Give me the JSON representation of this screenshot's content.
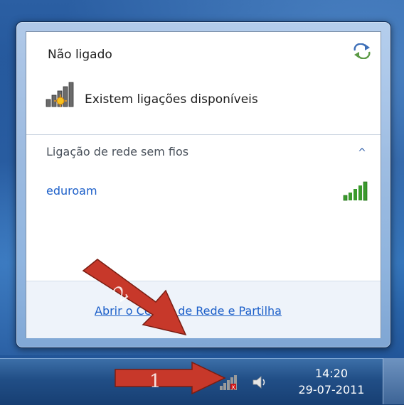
{
  "flyout": {
    "status_title": "Não ligado",
    "availability_text": "Existem ligações disponíveis",
    "section_title": "Ligação de rede sem fios",
    "collapse_glyph": "^",
    "networks": [
      {
        "name": "eduroam",
        "signal_icon": "signal-strength-icon"
      }
    ],
    "footer_link": "Abrir o Centro de Rede e Partilha",
    "refresh_icon": "refresh-icon"
  },
  "annotations": {
    "step1": "1",
    "step2": "2",
    "arrow_color": "#c7382a"
  },
  "taskbar": {
    "clock_time": "14:20",
    "clock_date": "29-07-2011",
    "tray_icons": [
      "network-icon",
      "volume-icon"
    ]
  },
  "colors": {
    "link_blue": "#1c5fc9",
    "signal_green": "#3a9a2c"
  }
}
